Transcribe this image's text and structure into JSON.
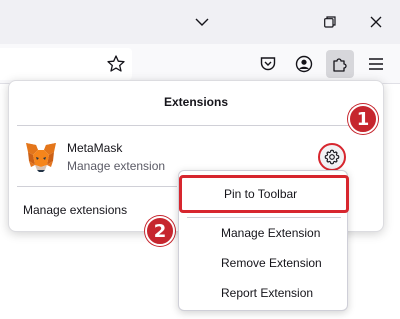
{
  "window": {
    "minimize_icon": "chevron-down-icon",
    "restore_icon": "restore-icon",
    "close_icon": "close-icon"
  },
  "toolbar": {
    "bookmark_icon": "star-icon",
    "pocket_icon": "pocket-icon",
    "account_icon": "account-icon",
    "extensions_icon": "puzzle-icon",
    "menu_icon": "hamburger-menu-icon"
  },
  "panel": {
    "title": "Extensions",
    "extension": {
      "name": "MetaMask",
      "subtitle": "Manage extension",
      "logo_icon": "metamask-fox-icon",
      "settings_icon": "gear-icon"
    },
    "manage_label": "Manage extensions"
  },
  "context_menu": {
    "items": [
      {
        "label": "Pin to Toolbar"
      },
      {
        "label": "Manage Extension"
      },
      {
        "label": "Remove Extension"
      },
      {
        "label": "Report Extension"
      }
    ]
  },
  "annotations": {
    "step1": "1",
    "step2": "2",
    "highlight_color": "#d7262e"
  }
}
